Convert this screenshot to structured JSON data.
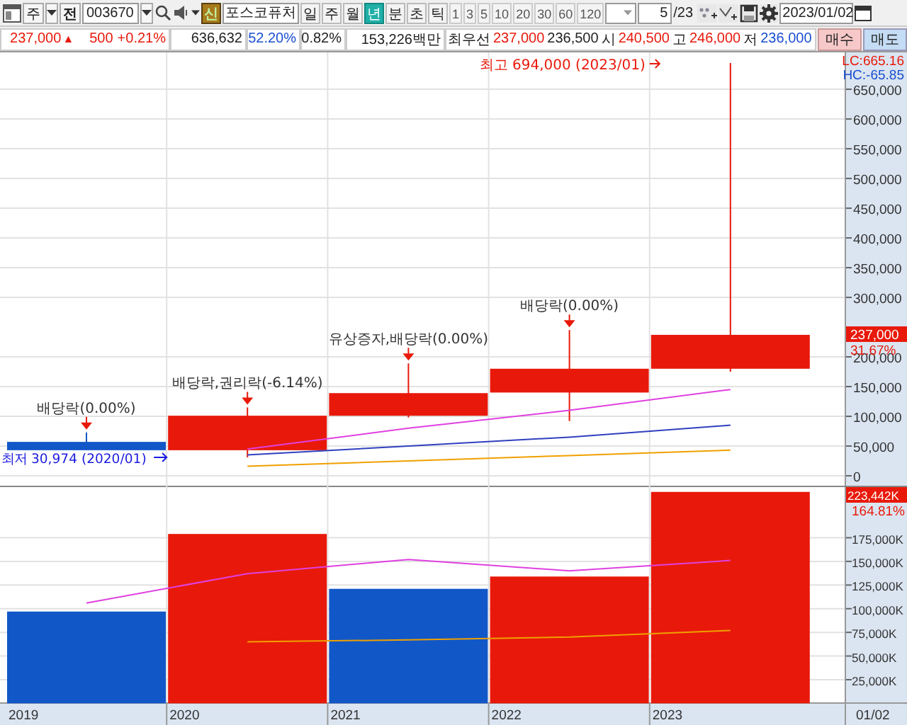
{
  "toolbar": {
    "market": "주",
    "market_button": "전",
    "code": "003670",
    "new_badge": "신",
    "name": "포스코퓨처",
    "periods": [
      {
        "label": "일",
        "selected": false
      },
      {
        "label": "주",
        "selected": false
      },
      {
        "label": "월",
        "selected": false
      },
      {
        "label": "년",
        "selected": true
      },
      {
        "label": "분",
        "selected": false
      },
      {
        "label": "초",
        "selected": false
      },
      {
        "label": "틱",
        "selected": false
      }
    ],
    "intervals": [
      "1",
      "3",
      "5",
      "10",
      "20",
      "30",
      "60",
      "120"
    ],
    "count": "5",
    "count_total": "/23",
    "date": "2023/01/02"
  },
  "quote": {
    "price": "237,000",
    "change_arrow": "▲",
    "change": "500",
    "change_rate": "+0.21%",
    "volume": "636,632",
    "volume_ratio": "52.20%",
    "turnover": "0.82%",
    "amount": "153,226백만",
    "best_label": "최우선",
    "ask": "237,000",
    "bid": "236,500",
    "open_label": "시",
    "open": "240,500",
    "high_label": "고",
    "high": "246,000",
    "low_label": "저",
    "low": "236,000",
    "buy": "매수",
    "sell": "매도"
  },
  "price_chart": {
    "lc": "LC:665.16",
    "hc": "HC:-65.85",
    "current_label": "237,000",
    "current_rate": "31.67%",
    "chart_data": {
      "type": "bar",
      "grid": true,
      "series": [
        {
          "type": "candlestick",
          "ohlc": [
            [
              57000,
              73000,
              42000,
              43000
            ],
            [
              43000,
              115000,
              30974,
              101000
            ],
            [
              101000,
              189000,
              98000,
              139000
            ],
            [
              140000,
              245000,
              92000,
              180000
            ],
            [
              180000,
              694000,
              175000,
              237000
            ]
          ]
        },
        {
          "type": "line",
          "color": "#e040e0",
          "values": [
            null,
            45000,
            80000,
            110000,
            145000
          ]
        },
        {
          "type": "line",
          "color": "#3040c0",
          "values": [
            null,
            35000,
            50000,
            65000,
            85000
          ]
        },
        {
          "type": "line",
          "color": "#f0a000",
          "values": [
            null,
            16000,
            25000,
            34000,
            43000
          ]
        }
      ],
      "ylim": [
        0,
        712000
      ],
      "yticks": [
        {
          "value": 0,
          "label": "0"
        },
        {
          "value": 50000,
          "label": "50,000"
        },
        {
          "value": 100000,
          "label": "100,000"
        },
        {
          "value": 150000,
          "label": "150,000"
        },
        {
          "value": 200000,
          "label": "200,000"
        },
        {
          "value": 300000,
          "label": "300,000"
        },
        {
          "value": 350000,
          "label": "350,000"
        },
        {
          "value": 400000,
          "label": "400,000"
        },
        {
          "value": 450000,
          "label": "450,000"
        },
        {
          "value": 500000,
          "label": "500,000"
        },
        {
          "value": 550000,
          "label": "550,000"
        },
        {
          "value": 600000,
          "label": "600,000"
        },
        {
          "value": 650000,
          "label": "650,000"
        }
      ],
      "annotations": [
        "배당락(0.00%)",
        "배당락,권리락(-6.14%)",
        "유상증자,배당락(0.00%)",
        "배당락(0.00%)",
        "최고 694,000 (2023/01)",
        "최저 30,974 (2020/01)"
      ]
    }
  },
  "volume_chart": {
    "current_label": "223,442K",
    "current_rate": "164.81%",
    "chart_data": {
      "type": "bar",
      "grid": true,
      "categories": [
        "2019",
        "2020",
        "2021",
        "2022",
        "2023"
      ],
      "series": [
        {
          "colors": [
            "#1157c8",
            "#e8190a",
            "#1157c8",
            "#e8190a",
            "#e8190a"
          ],
          "values": [
            97000,
            179000,
            121000,
            134000,
            223442
          ]
        },
        {
          "type": "line",
          "color": "#e040e0",
          "values": [
            106000,
            137000,
            152000,
            140000,
            151000
          ]
        },
        {
          "type": "line",
          "color": "#f0a000",
          "values": [
            null,
            65000,
            67000,
            70000,
            77000
          ]
        }
      ],
      "ylim": [
        0,
        230000
      ],
      "yticks": [
        {
          "value": 25000,
          "label": "25,000K"
        },
        {
          "value": 50000,
          "label": "50,000K"
        },
        {
          "value": 75000,
          "label": "75,000K"
        },
        {
          "value": 100000,
          "label": "100,000K"
        },
        {
          "value": 125000,
          "label": "125,000K"
        },
        {
          "value": 150000,
          "label": "150,000K"
        },
        {
          "value": 175000,
          "label": "175,000K"
        }
      ]
    }
  },
  "x_axis": {
    "right_label": "01/02"
  }
}
